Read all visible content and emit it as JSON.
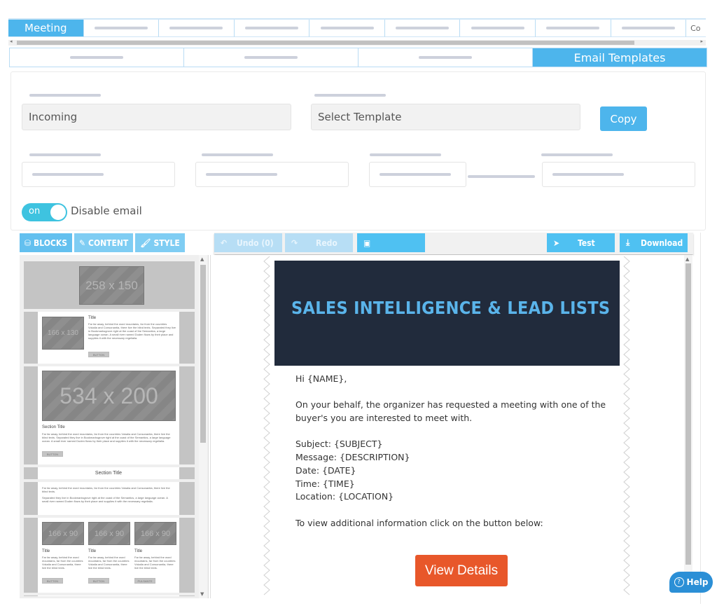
{
  "top_tabs": {
    "active": "Meeting",
    "items": [
      "Meeting",
      "",
      "",
      "",
      "",
      "",
      "",
      "",
      "",
      "Co"
    ]
  },
  "sub_tabs": {
    "items": [
      "",
      "",
      "",
      "Email Templates"
    ],
    "active": "Email Templates"
  },
  "settings": {
    "template_type_value": "Incoming",
    "select_template_placeholder": "Select Template",
    "copy_label": "Copy",
    "toggle_state": "on",
    "toggle_label": "Disable email"
  },
  "editor": {
    "left_tabs": [
      {
        "icon": "blocks-icon",
        "label": "BLOCKS"
      },
      {
        "icon": "pencil-icon",
        "label": "CONTENT"
      },
      {
        "icon": "brush-icon",
        "label": "STYLE"
      }
    ],
    "toolbar": {
      "undo_label": "Undo (0)",
      "redo_label": "Redo",
      "test_label": "Test",
      "download_label": "Download"
    },
    "blocks": {
      "ph_258": "258 x 150",
      "ph_166x130": "166 x 130",
      "ph_534": "534 x 200",
      "ph_166x90": "166 x 90",
      "title": "Title",
      "section_title": "Section Title",
      "lorem": "Far far away, behind the word mountains, far from the countries Vokalia and Consonantia, there live the blind texts. Separated they live in Bookmarksgrove right at the coast of the Semantics, a large language ocean. A small river named Duden flows by their place and supplies it with the necessary regelialia.",
      "lorem_short": "Far far away, behind the word mountains, far from the countries Vokalia and Consonantia, there live the blind texts.",
      "lorem_second": "Separated they live in Bookmarksgrove right at the coast of the Semantics, a large language ocean. A small river named Duden flows by their place and supplies it with the necessary regelialia.",
      "button": "BUTTON",
      "button_alt": "PULSANTE"
    }
  },
  "email": {
    "banner_title": "SALES INTELLIGENCE & LEAD LISTS",
    "greeting": "Hi {NAME},",
    "intro_line1": "On your behalf, the organizer has requested a meeting with one of the",
    "intro_line2": "buyer's you are interested to meet with.",
    "subject": "Subject: {SUBJECT}",
    "message": "Message: {DESCRIPTION}",
    "date": "Date: {DATE}",
    "time": "Time: {TIME}",
    "location": "Location: {LOCATION}",
    "cta_text": "To view additional information click on the button below:",
    "cta_button": "View Details",
    "cta_color": "#e8572a",
    "banner_bg": "#212b3c",
    "banner_text_color": "#5ab4ea"
  },
  "help": {
    "label": "Help"
  },
  "colors": {
    "accent": "#4db5ec",
    "toggle": "#3ec3e0"
  }
}
